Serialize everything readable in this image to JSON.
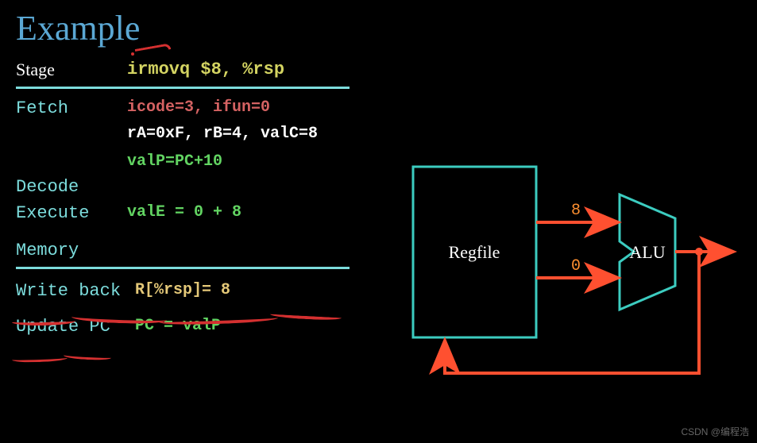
{
  "title": "Example",
  "header": {
    "stage": "Stage",
    "instruction": "irmovq $8, %rsp"
  },
  "stages": {
    "fetch": {
      "name": "Fetch",
      "line1": "icode=3, ifun=0",
      "line2": "rA=0xF, rB=4, valC=8",
      "line3": "valP=PC+10"
    },
    "decode": {
      "name": "Decode"
    },
    "execute": {
      "name": "Execute",
      "line": "valE = 0 + 8"
    },
    "memory": {
      "name": "Memory"
    },
    "writeback": {
      "name": "Write back",
      "line": "R[%rsp]= 8"
    },
    "updatepc": {
      "name": "Update PC",
      "line": "PC = valP"
    }
  },
  "diagram": {
    "regfile": "Regfile",
    "alu": "ALU",
    "top_signal": "8",
    "bottom_signal": "0"
  },
  "watermark": "CSDN @编程浩"
}
